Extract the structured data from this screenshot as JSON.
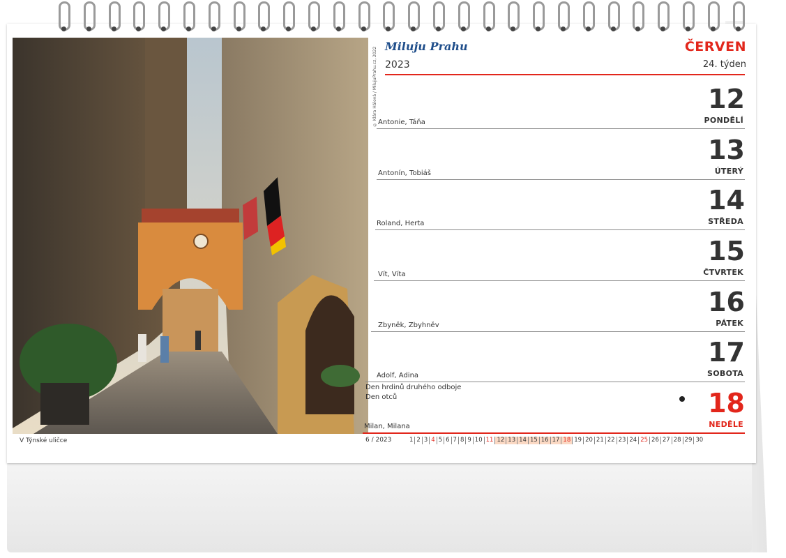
{
  "calendar": {
    "brand": "Miluju Prahu",
    "month": "ČERVEN",
    "year": "2023",
    "week": "24. týden",
    "copyright": "© Klára Hálová / MilujuPrahu.cz, 2022",
    "photo_caption": "V Týnské uličce",
    "days": [
      {
        "num": "12",
        "weekday": "PONDĚLÍ",
        "names": "Antonie, Táňa"
      },
      {
        "num": "13",
        "weekday": "ÚTERÝ",
        "names": "Antonín, Tobiáš"
      },
      {
        "num": "14",
        "weekday": "STŘEDA",
        "names": "Roland, Herta"
      },
      {
        "num": "15",
        "weekday": "ČTVRTEK",
        "names": "Vít, Víta"
      },
      {
        "num": "16",
        "weekday": "PÁTEK",
        "names": "Zbyněk, Zbyhněv"
      },
      {
        "num": "17",
        "weekday": "SOBOTA",
        "names": "Adolf, Adina"
      },
      {
        "num": "18",
        "weekday": "NEDĚLE",
        "names": "Milan, Milana",
        "holidays": [
          "Den hrdinů druhého odboje",
          "Den otců"
        ]
      }
    ],
    "mini_label": "6 / 2023",
    "mini_days": [
      "1",
      "2",
      "3",
      "4",
      "5",
      "6",
      "7",
      "8",
      "9",
      "10",
      "11",
      "12",
      "13",
      "14",
      "15",
      "16",
      "17",
      "18",
      "19",
      "20",
      "21",
      "22",
      "23",
      "24",
      "25",
      "26",
      "27",
      "28",
      "29",
      "30"
    ],
    "highlight_range": [
      12,
      18
    ],
    "sundays": [
      4,
      11,
      18,
      25
    ],
    "colors": {
      "accent": "#e2261b",
      "brand": "#1e4d8a",
      "highlight": "#fbd9c4"
    }
  }
}
